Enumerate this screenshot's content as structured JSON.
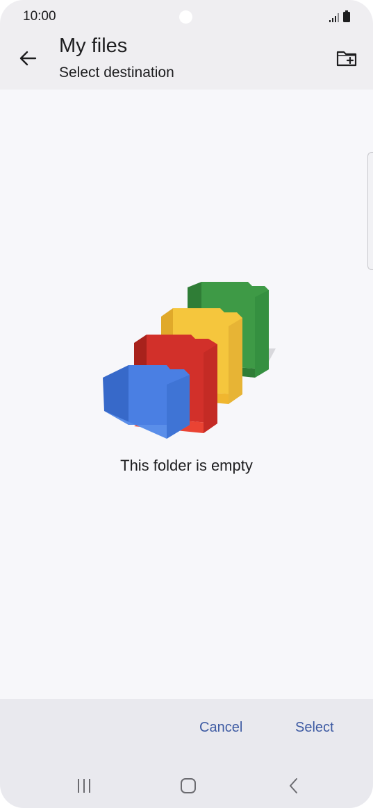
{
  "status_bar": {
    "time": "10:00",
    "icons": [
      "signal-icon",
      "battery-icon"
    ]
  },
  "app_bar": {
    "title": "My files",
    "subtitle": "Select destination",
    "back_icon": "arrow-back-icon",
    "new_folder_icon": "create-folder-icon"
  },
  "content": {
    "empty_message": "This folder is empty",
    "illustration": "empty-folders-illustration"
  },
  "actions": {
    "cancel_label": "Cancel",
    "select_label": "Select"
  },
  "nav_bar": {
    "icons": [
      "recent-apps-icon",
      "home-icon",
      "back-icon"
    ]
  },
  "colors": {
    "accent": "#3e5ba3",
    "folder_blue": "#4a7fe3",
    "folder_red": "#d2302a",
    "folder_yellow": "#f5c63d",
    "folder_green": "#3e9a46"
  }
}
